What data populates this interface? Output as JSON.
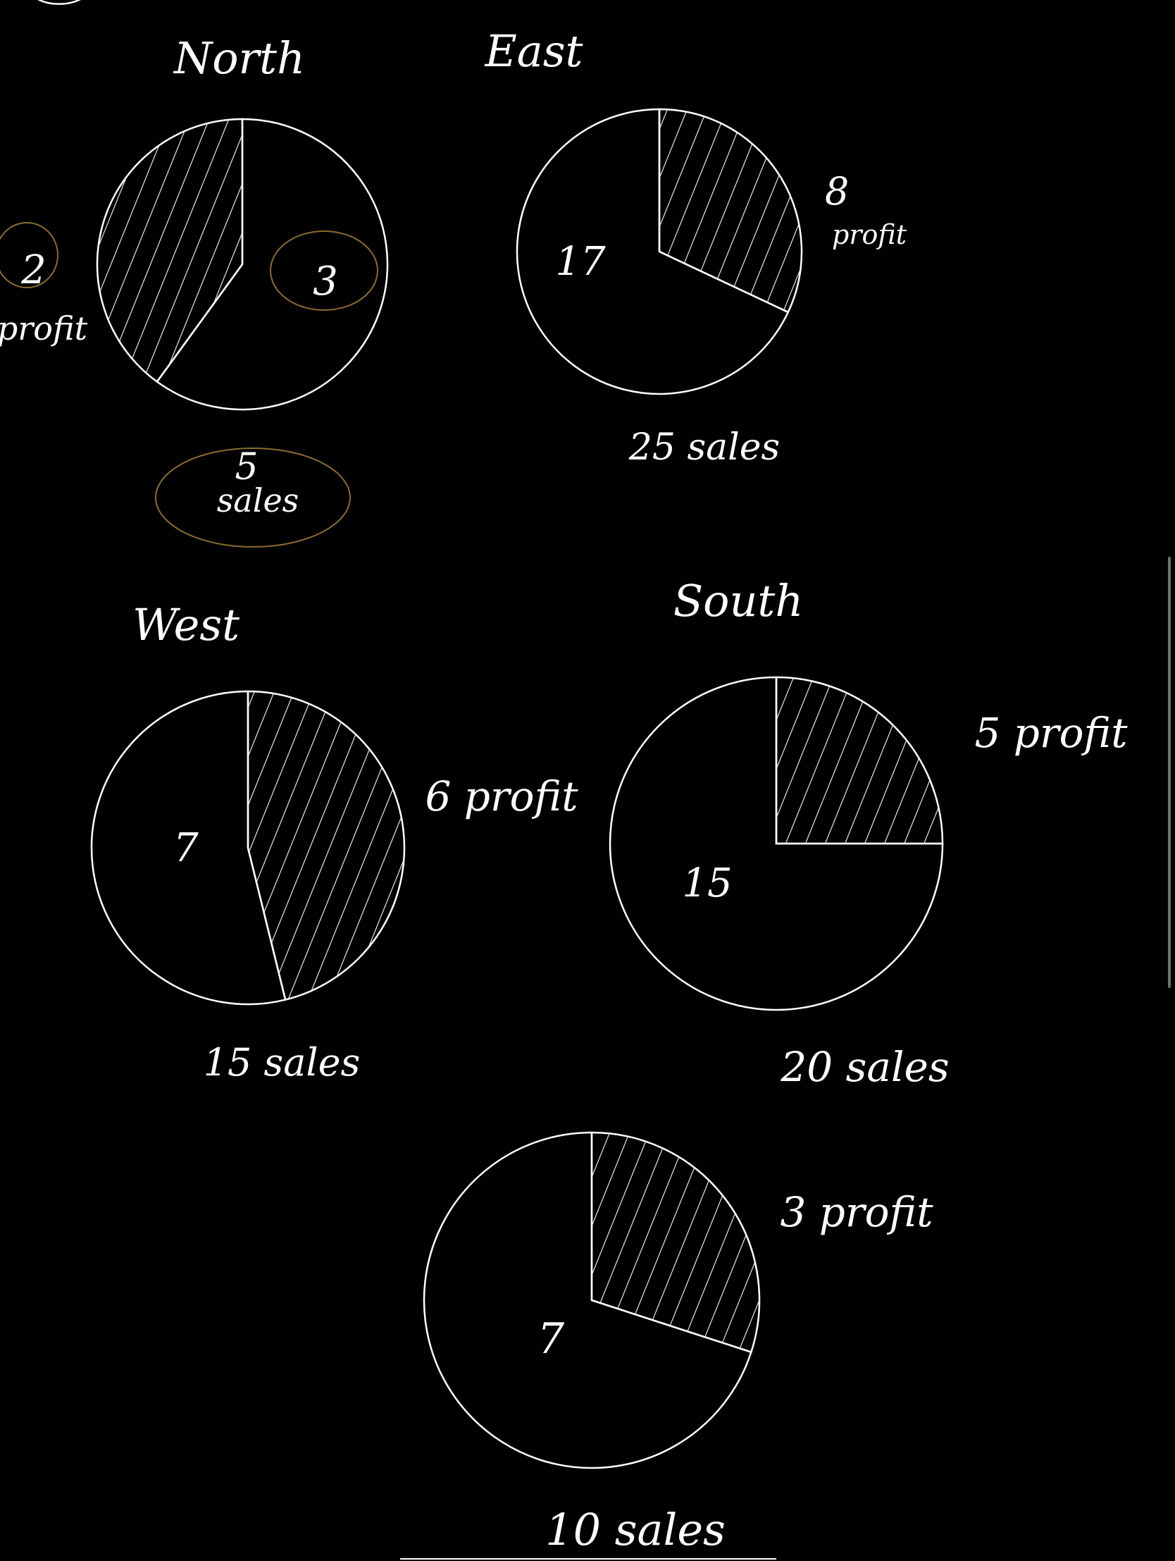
{
  "colors": {
    "background": "#000000",
    "ink": "#ffffff",
    "highlight": "#8a6d2e"
  },
  "chart_data": [
    {
      "type": "pie",
      "title": "North",
      "categories": [
        "profit",
        ""
      ],
      "values": [
        2,
        3
      ],
      "slice_labels": [
        "2",
        "3"
      ],
      "profit_label": "profit",
      "total_label": "5",
      "total_unit": "sales",
      "hatched": "profit"
    },
    {
      "type": "pie",
      "title": "East",
      "categories": [
        "profit",
        ""
      ],
      "values": [
        8,
        17
      ],
      "slice_labels": [
        "8",
        "17"
      ],
      "profit_label": "profit",
      "total_label": "25 sales",
      "hatched": "profit"
    },
    {
      "type": "pie",
      "title": "West",
      "categories": [
        "profit",
        ""
      ],
      "values": [
        6,
        7
      ],
      "slice_labels": [
        "6",
        "7"
      ],
      "profit_label": "6 profit",
      "total_label": "15 sales",
      "hatched": "profit"
    },
    {
      "type": "pie",
      "title": "South",
      "categories": [
        "profit",
        ""
      ],
      "values": [
        5,
        15
      ],
      "slice_labels": [
        "5",
        "15"
      ],
      "profit_label": "5 profit",
      "total_label": "20 sales",
      "hatched": "profit"
    },
    {
      "type": "pie",
      "title": "",
      "categories": [
        "profit",
        ""
      ],
      "values": [
        3,
        7
      ],
      "slice_labels": [
        "3",
        "7"
      ],
      "profit_label": "3 profit",
      "total_label": "10 sales",
      "hatched": "profit"
    }
  ]
}
